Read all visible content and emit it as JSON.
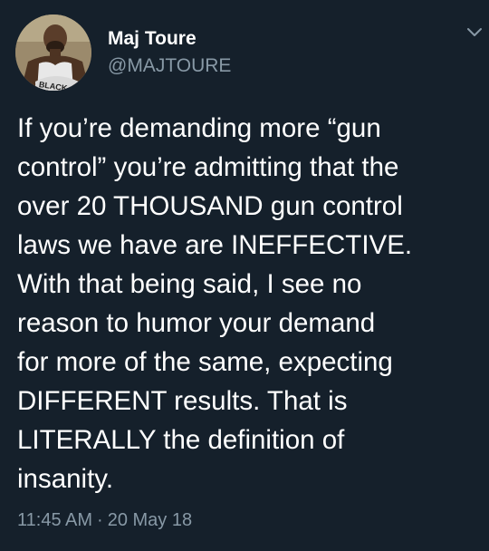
{
  "tweet": {
    "display_name": "Maj Toure",
    "handle": "@MAJTOURE",
    "avatar_text": "BLACK",
    "body_lines": [
      "If you’re demanding more “gun",
      "control” you’re admitting that the",
      "over 20 THOUSAND gun control",
      "laws we have are INEFFECTIVE.",
      "With that being said, I see no",
      "reason to humor your demand",
      "for more of the same, expecting",
      "DIFFERENT results. That is",
      "LITERALLY the definition of",
      "insanity."
    ],
    "time": "11:45 AM",
    "separator": "·",
    "date": "20 May 18"
  },
  "icons": {
    "menu": "chevron-down-icon"
  },
  "colors": {
    "background": "#15202b",
    "text": "#ffffff",
    "secondary_text": "#8899a6"
  }
}
